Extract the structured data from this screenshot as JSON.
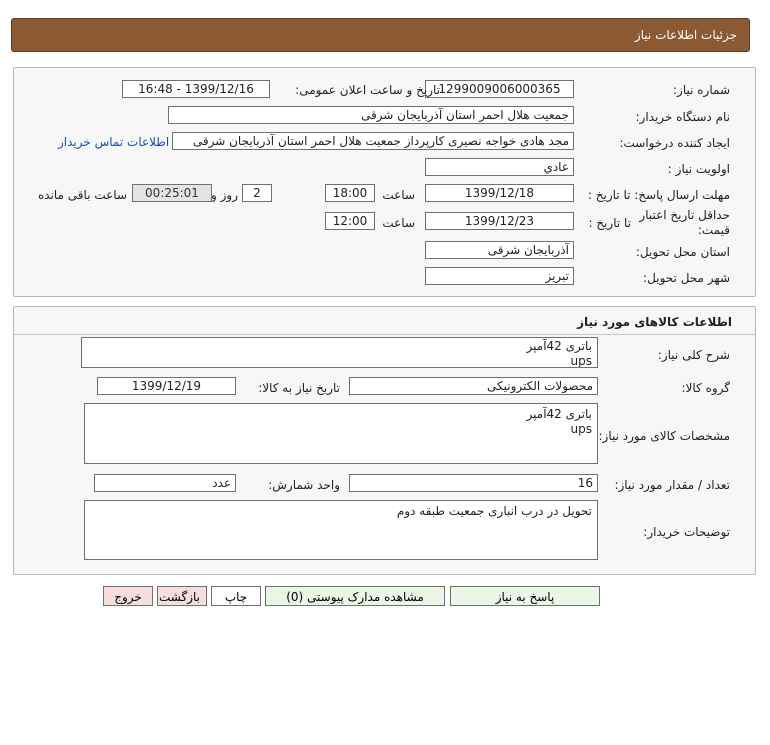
{
  "header": {
    "title": "جزئیات اطلاعات نیاز"
  },
  "details": {
    "need_number_label": "شماره نیاز:",
    "need_number": "1299009006000365",
    "announce_label": "تاریخ و ساعت اعلان عمومی:",
    "announce_value": "1399/12/16 - 16:48",
    "buyer_org_label": "نام دستگاه خریدار:",
    "buyer_org": "جمعیت هلال احمر استان آذربایجان شرقی",
    "requester_label": "ایجاد کننده درخواست:",
    "requester": "مجد هادی خواجه نصیری کارپرداز جمعیت هلال احمر استان آذربایجان شرقی",
    "contact_link": "اطلاعات تماس خریدار",
    "priority_label": "اولویت نیاز :",
    "priority": "عادي",
    "deadline_label": "مهلت ارسال پاسخ: تا تاریخ :",
    "deadline_date": "1399/12/18",
    "time_label": "ساعت",
    "deadline_time": "18:00",
    "days_value": "2",
    "days_label": "روز و",
    "remaining_time": "00:25:01",
    "remaining_label": "ساعت باقی مانده",
    "validity_label": "حداقل تاریخ اعتبار قیمت:",
    "validity_to_label": "تا تاریخ :",
    "validity_date": "1399/12/23",
    "validity_time_label": "ساعت",
    "validity_time": "12:00",
    "province_label": "استان محل تحویل:",
    "province": "آذربایجان شرقی",
    "city_label": "شهر محل تحویل:",
    "city": "تبریز"
  },
  "goods": {
    "section_title": "اطلاعات کالاهای مورد نیاز",
    "summary_label": "شرح کلی نیاز:",
    "summary": "باتری 42آمپر\nups",
    "group_label": "گروه کالا:",
    "group": "محصولات الکترونیکی",
    "need_date_label": "تاریخ نیاز به کالا:",
    "need_date": "1399/12/19",
    "specs_label": "مشخصات کالای مورد نیاز:",
    "specs": "باتری 42آمپر\nups",
    "qty_label": "تعداد / مقدار مورد نیاز:",
    "qty": "16",
    "unit_label": "واحد شمارش:",
    "unit": "عدد",
    "buyer_notes_label": "توضیحات خریدار:",
    "buyer_notes": "تحویل در درب انباری جمعیت طبقه دوم"
  },
  "buttons": {
    "reply": "پاسخ به نیاز",
    "attachments": "مشاهده مدارک پیوستی (0)",
    "print": "چاپ",
    "back": "بازگشت",
    "exit": "خروج"
  },
  "colors": {
    "header_bg": "#8b5a33",
    "link": "#1a4fb5"
  }
}
